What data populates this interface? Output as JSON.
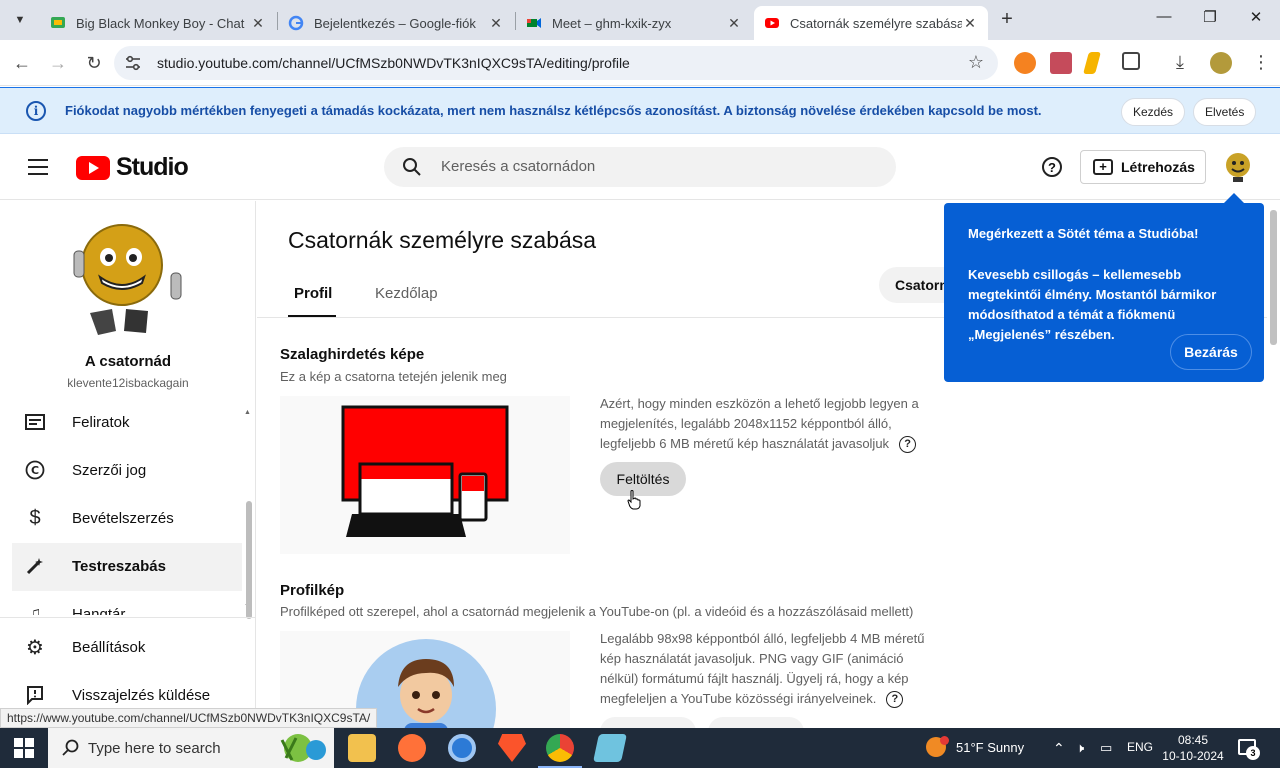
{
  "browser": {
    "tabs": [
      {
        "title": "Big Black Monkey Boy - Chat",
        "favicon": "google-chat-icon"
      },
      {
        "title": "Bejelentkezés – Google-fiók",
        "favicon": "google-icon"
      },
      {
        "title": "Meet – ghm-kxik-zyx",
        "favicon": "meet-icon"
      },
      {
        "title": "Csatornák személyre szabása -",
        "favicon": "youtube-studio-icon",
        "active": true
      }
    ],
    "url": "studio.youtube.com/channel/UCfMSzb0NWDvTK3nIQXC9sTA/editing/profile"
  },
  "banner": {
    "message": "Fiókodat nagyobb mértékben fenyegeti a támadás kockázata, mert nem használsz kétlépcsős azonosítást. A biztonság növelése érdekében kapcsold be most.",
    "start_label": "Kezdés",
    "dismiss_label": "Elvetés"
  },
  "header": {
    "logo_text": "Studio",
    "search_placeholder": "Keresés a csatornádon",
    "create_label": "Létrehozás"
  },
  "sidebar": {
    "channel_name": "A csatornád",
    "channel_handle": "klevente12isbackagain",
    "items": [
      {
        "label": "Feliratok",
        "icon": "subtitles-icon"
      },
      {
        "label": "Szerzői jog",
        "icon": "copyright-icon"
      },
      {
        "label": "Bevételszerzés",
        "icon": "dollar-icon"
      },
      {
        "label": "Testreszabás",
        "icon": "magic-wand-icon",
        "active": true
      },
      {
        "label": "Hangtár",
        "icon": "audio-library-icon"
      }
    ],
    "bottom_items": [
      {
        "label": "Beállítások",
        "icon": "gear-icon"
      },
      {
        "label": "Visszajelzés küldése",
        "icon": "feedback-icon"
      }
    ]
  },
  "main": {
    "title": "Csatornák személyre szabása",
    "tabs": [
      "Profil",
      "Kezdőlap"
    ],
    "channel_button": "Csatorna",
    "banner_section": {
      "title": "Szalaghirdetés képe",
      "subtitle": "Ez a kép a csatorna tetején jelenik meg",
      "description": "Azért, hogy minden eszközön a lehető legjobb legyen a megjelenítés, legalább 2048x1152 képpontból álló, legfeljebb 6 MB méretű kép használatát javasoljuk",
      "upload_label": "Feltöltés"
    },
    "profile_section": {
      "title": "Profilkép",
      "subtitle": "Profilképed ott szerepel, ahol a csatornád megjelenik a YouTube-on (pl. a videóid és a hozzászólásaid mellett)",
      "description": "Legalább 98x98 képpontból álló, legfeljebb 4 MB méretű kép használatát javasoljuk. PNG vagy GIF (animáció nélkül) formátumú fájlt használj. Ügyelj rá, hogy a kép megfeleljen a YouTube közösségi irányelveinek."
    }
  },
  "popup": {
    "title": "Megérkezett a Sötét téma a Studióba!",
    "body": "Kevesebb csillogás – kellemesebb megtekintői élmény. Mostantól bármikor módosíthatod a témát a fiókmenü „Megjelenés” részében.",
    "close_label": "Bezárás"
  },
  "status_url": "https://www.youtube.com/channel/UCfMSzb0NWDvTK3nIQXC9sTA/",
  "taskbar": {
    "search_placeholder": "Type here to search",
    "weather": "51°F  Sunny",
    "language": "ENG",
    "time": "08:45",
    "date": "10-10-2024",
    "notification_count": "3"
  }
}
